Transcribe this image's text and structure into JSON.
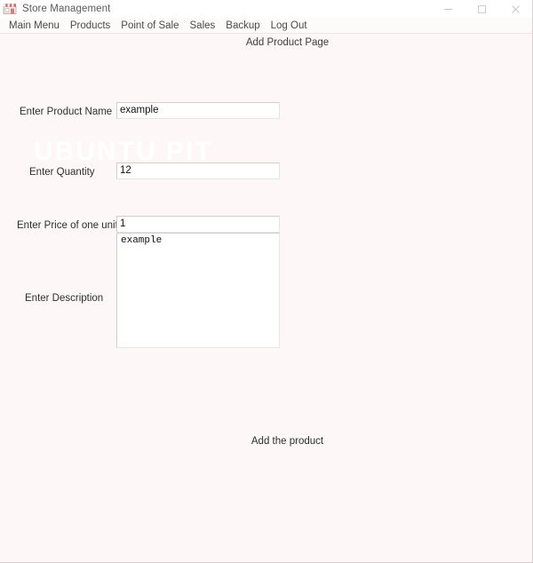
{
  "window": {
    "title": "Store Management",
    "icon": "store-icon",
    "controls": {
      "minimize": "minimize-icon",
      "maximize": "maximize-icon",
      "close": "close-icon"
    }
  },
  "menubar": {
    "items": [
      {
        "label": "Main Menu"
      },
      {
        "label": "Products"
      },
      {
        "label": "Point of Sale"
      },
      {
        "label": "Sales"
      },
      {
        "label": "Backup"
      },
      {
        "label": "Log Out"
      }
    ]
  },
  "page": {
    "title": "Add Product Page",
    "watermark": "UBUNTU PIT"
  },
  "form": {
    "fields": [
      {
        "label": "Enter Product Name",
        "value": "example",
        "placeholder": ""
      },
      {
        "label": "Enter Quantity",
        "value": "12",
        "placeholder": ""
      },
      {
        "label": "Enter Price of one unit",
        "value": "1",
        "placeholder": ""
      },
      {
        "label": "Enter Description",
        "value": "example",
        "placeholder": ""
      }
    ],
    "submit_label": "Add the product"
  },
  "colors": {
    "background": "#fdf8f7",
    "titlebar": "#ffffff",
    "input_background": "#ffffff",
    "input_border": "#cfcfcf",
    "text": "#2e2e2e"
  }
}
